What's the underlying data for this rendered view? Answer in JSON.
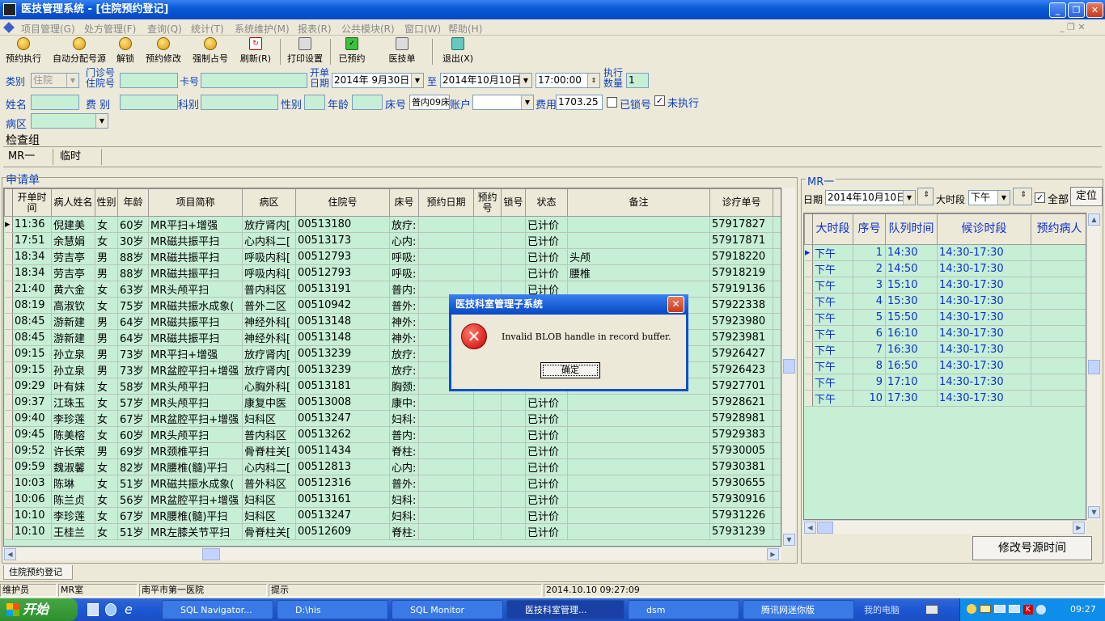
{
  "window": {
    "title": "医技管理系统 - [住院预约登记]"
  },
  "menu": [
    "项目管理(G)",
    "处方管理(F)",
    "查询(Q)",
    "统计(T)",
    "系统维护(M)",
    "报表(R)",
    "公共模块(R)",
    "窗口(W)",
    "帮助(H)"
  ],
  "toolbar": [
    "预约执行",
    "自动分配号源",
    "解锁",
    "预约修改",
    "强制占号",
    "刷新(R)",
    "打印设置",
    "已预约",
    "医技单",
    "退出(X)"
  ],
  "form": {
    "type_label": "类别",
    "type_value": "住院",
    "outpt_label": "门诊号",
    "inpt_label": "住院号",
    "card_label": "卡号",
    "date_label1": "开单",
    "date_label2": "日期",
    "date_from": "2014年 9月30日",
    "to_label": "至",
    "date_to": "2014年10月10日",
    "time": "17:00:00",
    "exec_label1": "执行",
    "exec_label2": "数量",
    "exec_count": "1",
    "name_label": "姓名",
    "fee_type_label": "费  别",
    "dept_label": "科别",
    "sex_label": "性别",
    "age_label": "年龄",
    "bed_label": "床号",
    "bed_value": "普内09床",
    "account_label": "账户",
    "cost_label": "费用",
    "cost_value": "1703.25",
    "locked_label": "已锁号",
    "unexec_label": "未执行",
    "ward_label": "病区"
  },
  "group": {
    "title": "检查组",
    "tabs": [
      "MR一",
      "临时"
    ]
  },
  "list": {
    "title": "申请单",
    "columns": [
      "开单时间",
      "病人姓名",
      "性别",
      "年龄",
      "项目简称",
      "病区",
      "住院号",
      "床号",
      "预约日期",
      "预约号",
      "锁号",
      "状态",
      "备注",
      "诊疗单号"
    ],
    "rows": [
      [
        "11:36",
        "倪建美",
        "女",
        "60岁",
        "MR平扫+增强",
        "放疗肾内[",
        "00513180",
        "放疗:",
        "",
        "",
        "",
        "已计价",
        "",
        "57917827"
      ],
      [
        "17:51",
        "余慧娟",
        "女",
        "30岁",
        "MR磁共振平扫",
        "心内科二[",
        "00513173",
        "心内:",
        "",
        "",
        "",
        "已计价",
        "",
        "57917871"
      ],
      [
        "18:34",
        "劳吉亭",
        "男",
        "88岁",
        "MR磁共振平扫",
        "呼吸内科[",
        "00512793",
        "呼吸:",
        "",
        "",
        "",
        "已计价",
        "头颅",
        "57918220"
      ],
      [
        "18:34",
        "劳吉亭",
        "男",
        "88岁",
        "MR磁共振平扫",
        "呼吸内科[",
        "00512793",
        "呼吸:",
        "",
        "",
        "",
        "已计价",
        "腰椎",
        "57918219"
      ],
      [
        "21:40",
        "黄六金",
        "女",
        "63岁",
        "MR头颅平扫",
        "普内科区",
        "00513191",
        "普内:",
        "",
        "",
        "",
        "已计价",
        "",
        "57919136"
      ],
      [
        "08:19",
        "高淑钦",
        "女",
        "75岁",
        "MR磁共振水成象(",
        "普外二区",
        "00510942",
        "普外:",
        "",
        "",
        "",
        "",
        "",
        "57922338"
      ],
      [
        "08:45",
        "游新建",
        "男",
        "64岁",
        "MR磁共振平扫",
        "神经外科[",
        "00513148",
        "神外:",
        "",
        "",
        "",
        "",
        "",
        "57923980"
      ],
      [
        "08:45",
        "游新建",
        "男",
        "64岁",
        "MR磁共振平扫",
        "神经外科[",
        "00513148",
        "神外:",
        "",
        "",
        "",
        "",
        "",
        "57923981"
      ],
      [
        "09:15",
        "孙立泉",
        "男",
        "73岁",
        "MR平扫+增强",
        "放疗肾内[",
        "00513239",
        "放疗:",
        "",
        "",
        "",
        "",
        "",
        "57926427"
      ],
      [
        "09:15",
        "孙立泉",
        "男",
        "73岁",
        "MR盆腔平扫+增强",
        "放疗肾内[",
        "00513239",
        "放疗:",
        "",
        "",
        "",
        "",
        "",
        "57926423"
      ],
      [
        "09:29",
        "叶有妹",
        "女",
        "58岁",
        "MR头颅平扫",
        "心胸外科[",
        "00513181",
        "胸颈:",
        "",
        "",
        "",
        "",
        "",
        "57927701"
      ],
      [
        "09:37",
        "江珠玉",
        "女",
        "57岁",
        "MR头颅平扫",
        "康复中医",
        "00513008",
        "康中:",
        "",
        "",
        "",
        "已计价",
        "",
        "57928621"
      ],
      [
        "09:40",
        "李珍莲",
        "女",
        "67岁",
        "MR盆腔平扫+增强",
        "妇科区",
        "00513247",
        "妇科:",
        "",
        "",
        "",
        "已计价",
        "",
        "57928981"
      ],
      [
        "09:45",
        "陈美榕",
        "女",
        "60岁",
        "MR头颅平扫",
        "普内科区",
        "00513262",
        "普内:",
        "",
        "",
        "",
        "已计价",
        "",
        "57929383"
      ],
      [
        "09:52",
        "许长荣",
        "男",
        "69岁",
        "MR颈椎平扫",
        "骨脊柱关[",
        "00511434",
        "脊柱:",
        "",
        "",
        "",
        "已计价",
        "",
        "57930005"
      ],
      [
        "09:59",
        "魏淑馨",
        "女",
        "82岁",
        "MR腰椎(髓)平扫",
        "心内科二[",
        "00512813",
        "心内:",
        "",
        "",
        "",
        "已计价",
        "",
        "57930381"
      ],
      [
        "10:03",
        "陈琳",
        "女",
        "51岁",
        "MR磁共振水成象(",
        "普外科区",
        "00512316",
        "普外:",
        "",
        "",
        "",
        "已计价",
        "",
        "57930655"
      ],
      [
        "10:06",
        "陈兰贞",
        "女",
        "56岁",
        "MR盆腔平扫+增强",
        "妇科区",
        "00513161",
        "妇科:",
        "",
        "",
        "",
        "已计价",
        "",
        "57930916"
      ],
      [
        "10:10",
        "李珍莲",
        "女",
        "67岁",
        "MR腰椎(髓)平扫",
        "妇科区",
        "00513247",
        "妇科:",
        "",
        "",
        "",
        "已计价",
        "",
        "57931226"
      ],
      [
        "10:10",
        "王桂兰",
        "女",
        "51岁",
        "MR左膝关节平扫",
        "骨脊柱关[",
        "00512609",
        "脊柱:",
        "",
        "",
        "",
        "已计价",
        "",
        "57931239"
      ]
    ]
  },
  "queue": {
    "title": "MR一",
    "date_label": "日期",
    "date": "2014年10月10日",
    "period_label": "大时段",
    "period": "下午",
    "all_label": "全部",
    "locate": "定位",
    "columns": [
      "大时段",
      "序号",
      "队列时间",
      "候诊时段",
      "预约病人"
    ],
    "rows": [
      [
        "下午",
        "1",
        "14:30",
        "14:30-17:30",
        ""
      ],
      [
        "下午",
        "2",
        "14:50",
        "14:30-17:30",
        ""
      ],
      [
        "下午",
        "3",
        "15:10",
        "14:30-17:30",
        ""
      ],
      [
        "下午",
        "4",
        "15:30",
        "14:30-17:30",
        ""
      ],
      [
        "下午",
        "5",
        "15:50",
        "14:30-17:30",
        ""
      ],
      [
        "下午",
        "6",
        "16:10",
        "14:30-17:30",
        ""
      ],
      [
        "下午",
        "7",
        "16:30",
        "14:30-17:30",
        ""
      ],
      [
        "下午",
        "8",
        "16:50",
        "14:30-17:30",
        ""
      ],
      [
        "下午",
        "9",
        "17:10",
        "14:30-17:30",
        ""
      ],
      [
        "下午",
        "10",
        "17:30",
        "14:30-17:30",
        ""
      ]
    ],
    "modify_btn": "修改号源时间"
  },
  "dialog": {
    "title": "医技科室管理子系统",
    "message": "Invalid BLOB handle in record buffer.",
    "ok": "确定"
  },
  "bottom_tab": "住院预约登记",
  "status": [
    "维护员",
    "MR室",
    "南平市第一医院",
    "提示",
    "2014.10.10 09:27:09"
  ],
  "taskbar": {
    "start": "开始",
    "tasks": [
      "SQL Navigator...",
      "D:\\his",
      "SQL Monitor",
      "医技科室管理...",
      "dsm",
      "腾讯网迷你版"
    ],
    "computer": "我的电脑",
    "clock": "09:27"
  }
}
